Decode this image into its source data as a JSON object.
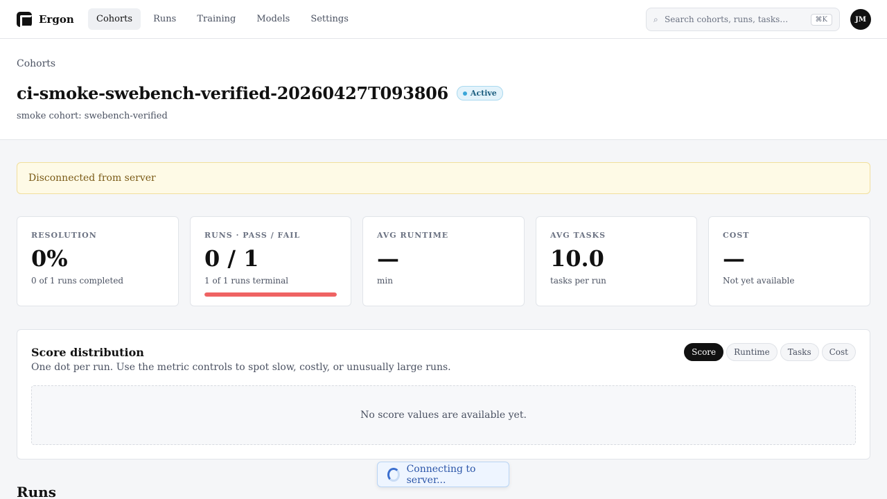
{
  "app": {
    "name": "Ergon"
  },
  "nav": {
    "items": [
      {
        "label": "Cohorts",
        "active": true
      },
      {
        "label": "Runs",
        "active": false
      },
      {
        "label": "Training",
        "active": false
      },
      {
        "label": "Models",
        "active": false
      },
      {
        "label": "Settings",
        "active": false
      }
    ]
  },
  "search": {
    "placeholder": "Search cohorts, runs, tasks…",
    "shortcut": "⌘K",
    "icon": "search-icon"
  },
  "user": {
    "initials": "JM"
  },
  "header": {
    "breadcrumb": "Cohorts",
    "title": "ci-smoke-swebench-verified-20260427T093806",
    "status": "Active",
    "subtitle": "smoke cohort: swebench-verified"
  },
  "alert": {
    "text": "Disconnected from server"
  },
  "stats": [
    {
      "label": "Resolution",
      "value": "0%",
      "sub": "0 of 1 runs completed"
    },
    {
      "label": "Runs · Pass / Fail",
      "value": "0 / 1",
      "sub": "1 of 1 runs terminal",
      "progress": 1.0
    },
    {
      "label": "Avg Runtime",
      "value": "—",
      "sub": "min"
    },
    {
      "label": "Avg Tasks",
      "value": "10.0",
      "sub": "tasks per run"
    },
    {
      "label": "Cost",
      "value": "—",
      "sub": "Not yet available"
    }
  ],
  "distribution": {
    "title": "Score distribution",
    "description": "One dot per run. Use the metric controls to spot slow, costly, or unusually large runs.",
    "metrics": [
      {
        "label": "Score",
        "active": true
      },
      {
        "label": "Runtime",
        "active": false
      },
      {
        "label": "Tasks",
        "active": false
      },
      {
        "label": "Cost",
        "active": false
      }
    ],
    "empty_text": "No score values are available yet."
  },
  "runs": {
    "heading": "Runs"
  },
  "toast": {
    "text": "Connecting to server..."
  },
  "colors": {
    "accent": "#111111",
    "failure": "#ef6363",
    "warning_bg": "#fefae6",
    "info": "#3b6fcf"
  }
}
